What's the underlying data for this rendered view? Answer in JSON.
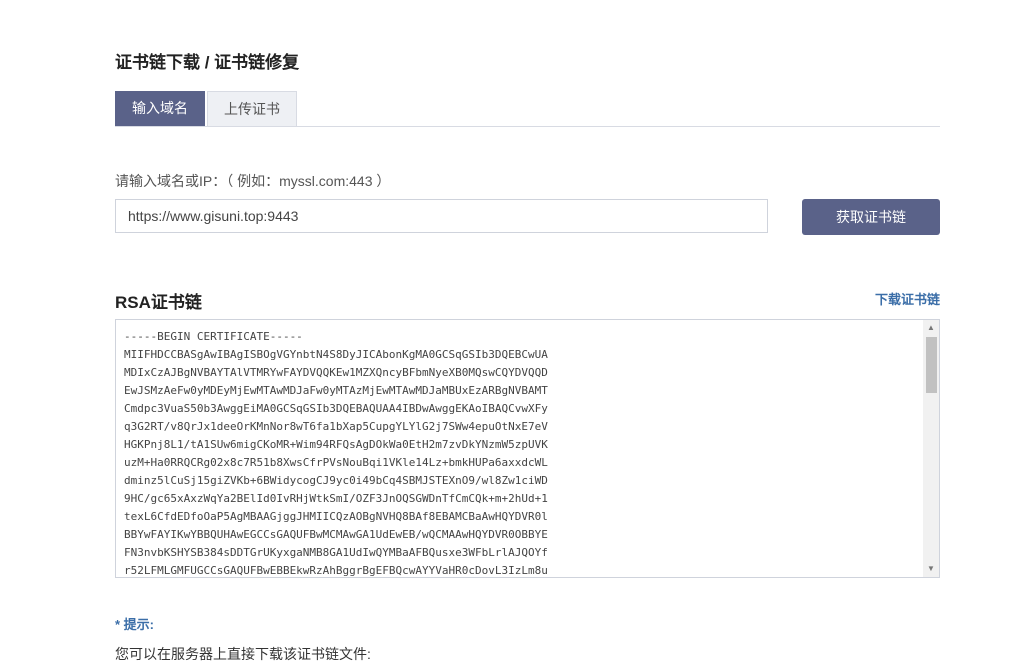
{
  "page": {
    "title": "证书链下载 / 证书链修复"
  },
  "tabs": [
    {
      "label": "输入域名",
      "active": true
    },
    {
      "label": "上传证书",
      "active": false
    }
  ],
  "form": {
    "label": "请输入域名或IP：（ 例如：myssl.com:443 ）",
    "input_value": "https://www.gisuni.top:9443",
    "button_label": "获取证书链"
  },
  "rsa": {
    "section_title": "RSA证书链",
    "download_label": "下载证书链",
    "certificate_text": "-----BEGIN CERTIFICATE-----\nMIIFHDCCBASgAwIBAgISBOgVGYnbtN4S8DyJICAbonKgMA0GCSqGSIb3DQEBCwUA\nMDIxCzAJBgNVBAYTAlVTMRYwFAYDVQQKEw1MZXQncyBFbmNyeXB0MQswCQYDVQQD\nEwJSMzAeFw0yMDEyMjEwMTAwMDJaFw0yMTAzMjEwMTAwMDJaMBUxEzARBgNVBAMT\nCmdpc3VuaS50b3AwggEiMA0GCSqGSIb3DQEBAQUAA4IBDwAwggEKAoIBAQCvwXFy\nq3G2RT/v8QrJx1deeOrKMnNor8wT6fa1bXap5CupgYLYlG2j7SWw4epuOtNxE7eV\nHGKPnj8L1/tA1SUw6migCKoMR+Wim94RFQsAgDOkWa0EtH2m7zvDkYNzmW5zpUVK\nuzM+Ha0RRQCRg02x8c7R51b8XwsCfrPVsNouBqi1VKle14Lz+bmkHUPa6axxdcWL\ndminz5lCuSj15giZVKb+6BWidycogCJ9yc0i49bCq4SBMJSTEXnO9/wl8Zw1ciWD\n9HC/gc65xAxzWqYa2BElId0IvRHjWtkSmI/OZF3JnOQSGWDnTfCmCQk+m+2hUd+1\ntexL6CfdEDfoOaP5AgMBAAGjggJHMIICQzAOBgNVHQ8BAf8EBAMCBaAwHQYDVR0l\nBBYwFAYIKwYBBQUHAwEGCCsGAQUFBwMCMAwGA1UdEwEB/wQCMAAwHQYDVR0OBBYE\nFN3nvbKSHYSB384sDDTGrUKyxgaNMB8GA1UdIwQYMBaAFBQusxe3WFbLrlAJQOYf\nr52LFMLGMFUGCCsGAQUFBwEBBEkwRzAhBggrBgEFBQcwAYYVaHR0cDovL3IzLm8u"
  },
  "hint": {
    "title": "* 提示:",
    "text": "您可以在服务器上直接下载该证书链文件:"
  },
  "colors": {
    "accent": "#5a6289",
    "link": "#3b6ea8"
  }
}
